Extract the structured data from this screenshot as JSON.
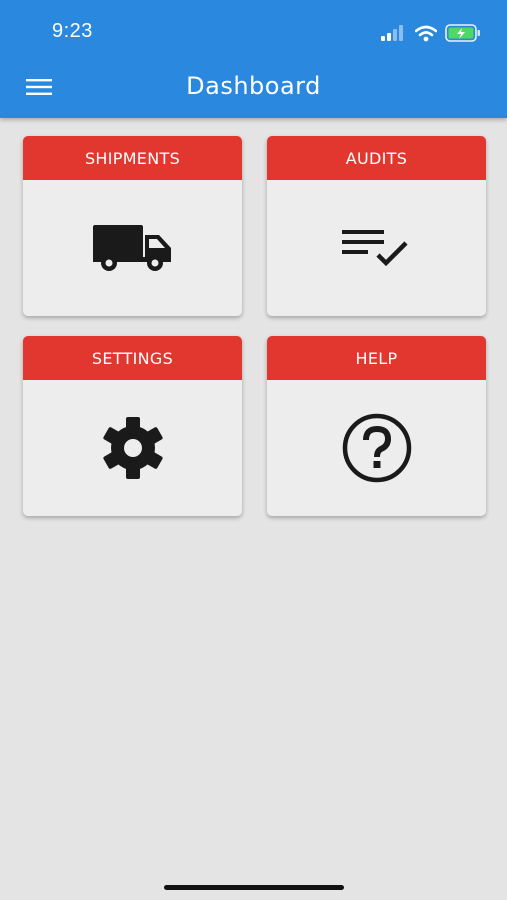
{
  "status_bar": {
    "time": "9:23"
  },
  "header": {
    "title": "Dashboard",
    "menu_icon": "hamburger-menu-icon",
    "background_color": "#2a89de"
  },
  "tiles": [
    {
      "label": "SHIPMENTS",
      "icon": "truck-icon"
    },
    {
      "label": "AUDITS",
      "icon": "checklist-icon"
    },
    {
      "label": "SETTINGS",
      "icon": "gear-icon"
    },
    {
      "label": "HELP",
      "icon": "help-circle-icon"
    }
  ],
  "colors": {
    "tile_header": "#e2372f",
    "tile_body": "#ededed",
    "page_background": "#e4e4e4",
    "icon": "#1a1a1a"
  }
}
